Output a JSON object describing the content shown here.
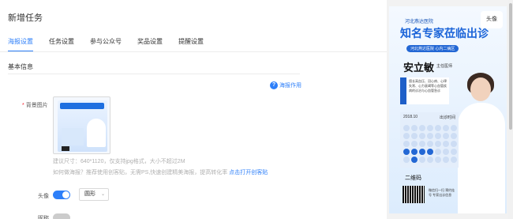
{
  "page": {
    "title": "新增任务"
  },
  "tabs": [
    {
      "label": "海报设置",
      "active": true
    },
    {
      "label": "任务设置"
    },
    {
      "label": "参与公众号"
    },
    {
      "label": "奖品设置"
    },
    {
      "label": "提醒设置"
    }
  ],
  "section": {
    "title": "基本信息"
  },
  "help": {
    "label": "海报作用",
    "icon": "question-circle-icon"
  },
  "background": {
    "label": "背景图片",
    "required_mark": "*",
    "hint_size": "建议尺寸：640*1120，仅支持jpg格式，大小不超过2M",
    "hint_howto_prefix": "如何做海报？推荐使用创客贴，无需PS,快速创建精美海报，提高转化率",
    "hint_link": "点击打开创客贴"
  },
  "avatar": {
    "label": "头像",
    "enabled": true,
    "shape_value": "圆形"
  },
  "nickname": {
    "label": "昵称",
    "enabled": false
  },
  "preview": {
    "hospital": "河北燕达医院",
    "headline": "知名专家莅临出诊",
    "tag": "河北燕达医院 心内二病区",
    "doctor_name": "安立敏",
    "doctor_rank": "主任医师",
    "description": "擅长高血压、冠心病、心律失常、心力衰竭等心血管疾病的诊治与心血管急诊",
    "calendar_month": "2018.10",
    "calendar_note": "出诊时间",
    "qr_label": "二维码",
    "qr_note": "微信扫一扫 预约挂号 专家出诊信息",
    "avatar_badge": "头像"
  },
  "colors": {
    "accent": "#2d7ff9",
    "poster_blue": "#1a63d8"
  }
}
